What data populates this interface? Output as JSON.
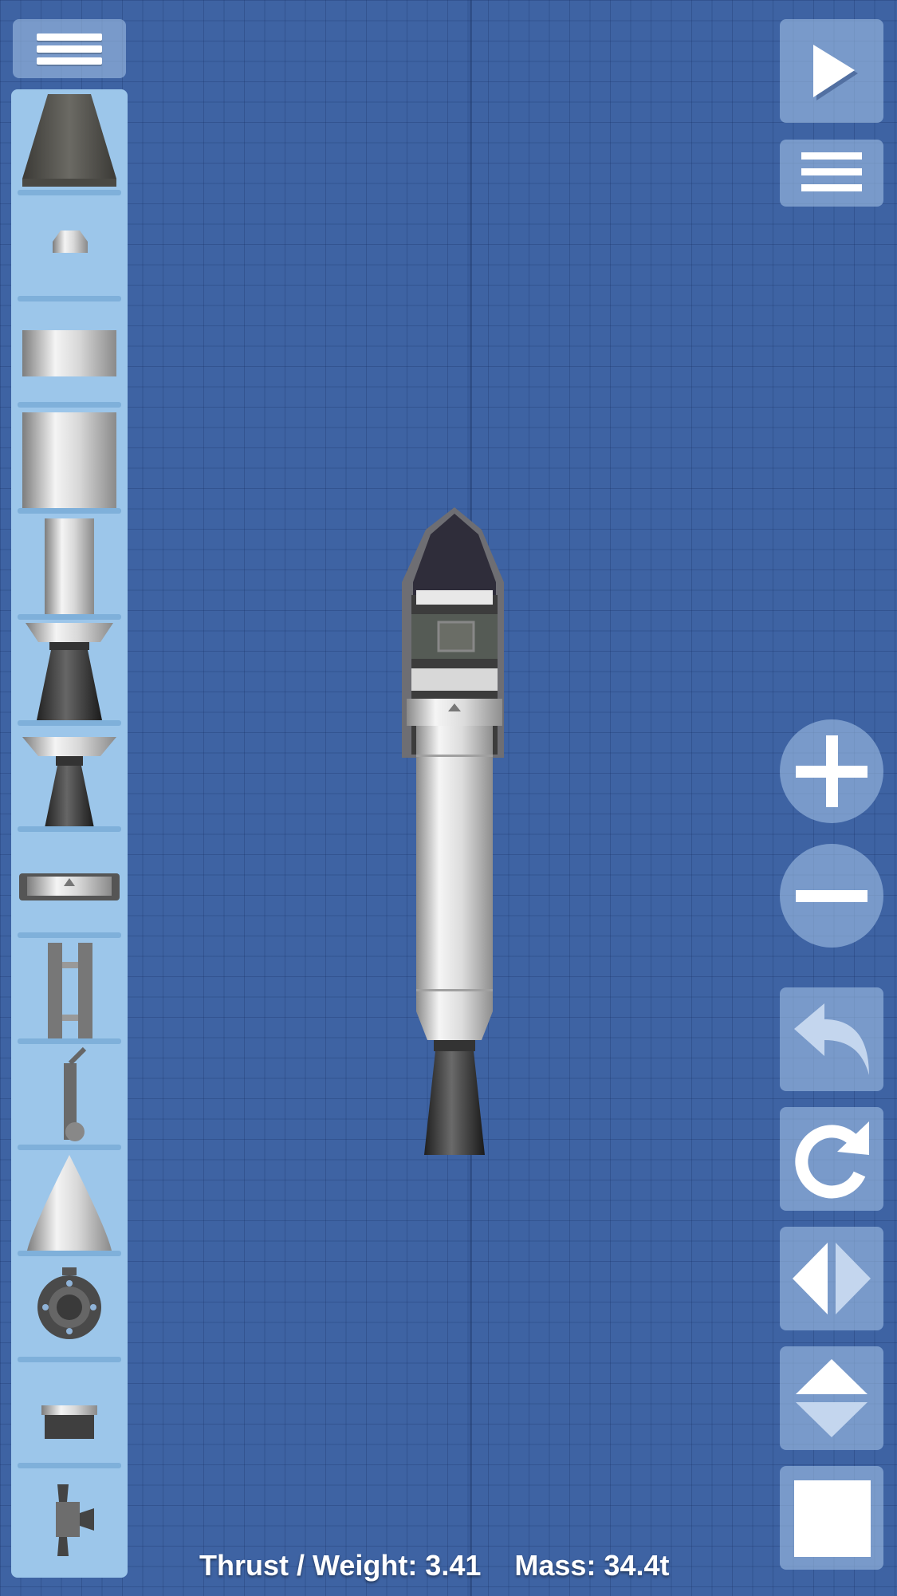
{
  "status": {
    "thrust_weight": "Thrust / Weight: 3.41",
    "mass": "Mass: 34.4t"
  },
  "top_left": {
    "icon": "hamburger-menu-icon"
  },
  "parts_panel": {
    "items": [
      {
        "name": "part-large-fairing-cone",
        "icon": "fairing-icon"
      },
      {
        "name": "part-small-cone",
        "icon": "small-cone-icon"
      },
      {
        "name": "part-short-fuel-tank",
        "icon": "fuel-tank-icon"
      },
      {
        "name": "part-tall-fuel-tank",
        "icon": "fuel-tank-icon"
      },
      {
        "name": "part-narrow-fuel-tank",
        "icon": "fuel-tank-icon"
      },
      {
        "name": "part-large-engine",
        "icon": "engine-icon"
      },
      {
        "name": "part-small-engine",
        "icon": "engine-icon"
      },
      {
        "name": "part-separator",
        "icon": "separator-icon"
      },
      {
        "name": "part-side-separator",
        "icon": "side-separator-icon"
      },
      {
        "name": "part-parachute",
        "icon": "parachute-icon"
      },
      {
        "name": "part-nose-cone",
        "icon": "nose-cone-icon"
      },
      {
        "name": "part-wheel",
        "icon": "wheel-icon"
      },
      {
        "name": "part-docking-port",
        "icon": "docking-port-icon"
      },
      {
        "name": "part-rcs-thruster",
        "icon": "rcs-icon"
      }
    ]
  },
  "right_controls": [
    {
      "name": "launch-button",
      "icon": "play-icon"
    },
    {
      "name": "options-button",
      "icon": "hamburger-menu-icon"
    },
    {
      "name": "zoom-in-button",
      "icon": "plus-icon"
    },
    {
      "name": "zoom-out-button",
      "icon": "minus-icon"
    },
    {
      "name": "undo-button",
      "icon": "undo-icon"
    },
    {
      "name": "redo-button",
      "icon": "redo-icon"
    },
    {
      "name": "flip-horizontal-button",
      "icon": "flip-horizontal-icon"
    },
    {
      "name": "flip-vertical-button",
      "icon": "flip-vertical-icon"
    },
    {
      "name": "delete-button",
      "icon": "square-icon"
    }
  ],
  "colors": {
    "background": "#3e63a3",
    "panel": "#9cc6ea",
    "button": "#aac8eb"
  }
}
